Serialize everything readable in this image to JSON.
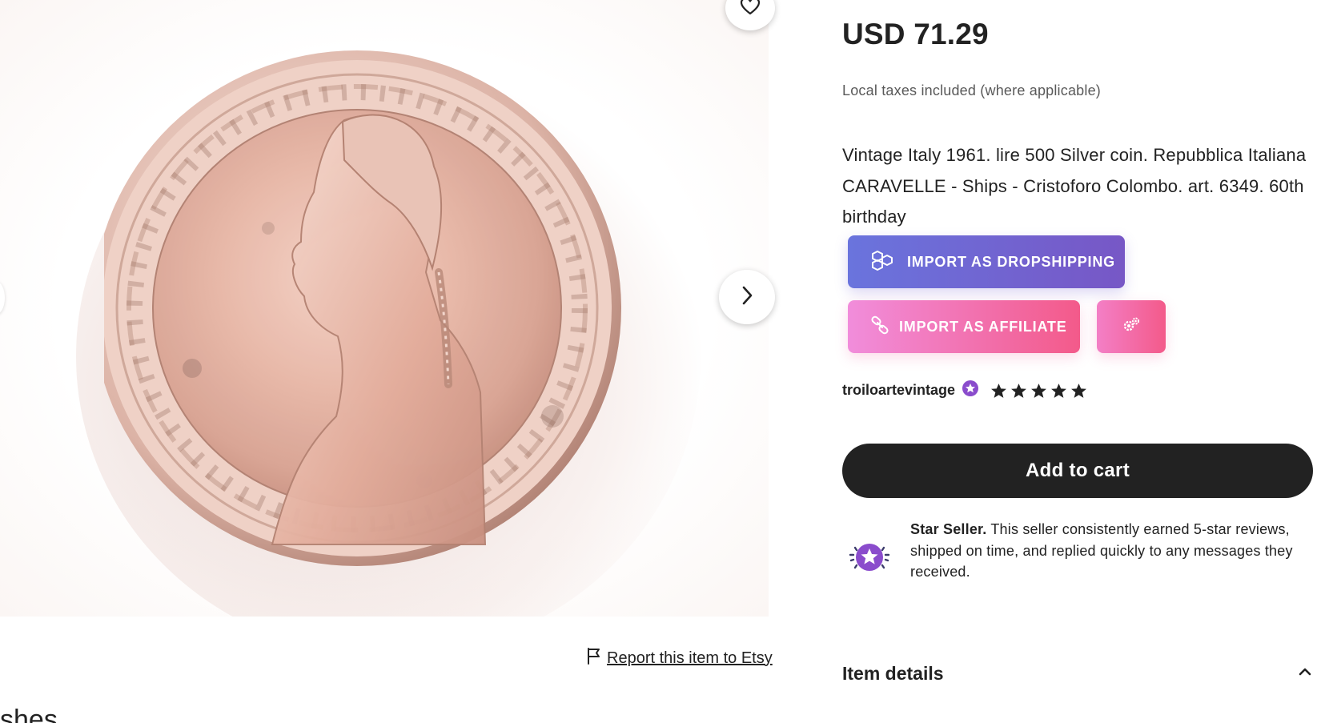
{
  "listing": {
    "price": "USD 71.29",
    "taxes_note": "Local taxes included (where applicable)",
    "title": "Vintage Italy 1961. lire 500 Silver coin. Repubblica Italiana CARAVELLE - Ships - Cristoforo Colombo. art. 6349. 60th birthday"
  },
  "actions": {
    "import_dropshipping": "IMPORT AS DROPSHIPPING",
    "import_affiliate": "IMPORT AS AFFILIATE",
    "add_to_cart": "Add to cart"
  },
  "seller": {
    "name": "troiloartevintage",
    "rating": 5,
    "rating_max": 5,
    "star_seller_heading": "Star Seller.",
    "star_seller_text": " This seller consistently earned 5-star reviews, shipped on time, and replied quickly to any messages they received."
  },
  "gallery": {
    "report_link": "Report this item to Etsy",
    "cut_off_text": "shes"
  },
  "item_details": {
    "heading": "Item details"
  },
  "colors": {
    "dropshipping_gradient": [
      "#6a74dd",
      "#7757c6"
    ],
    "affiliate_gradient": [
      "#f18ddb",
      "#f35a8a"
    ],
    "star_seller_purple": "#8a4ccc",
    "cart_bg": "#222222"
  },
  "icons": {
    "favorite": "heart-icon",
    "next_image": "chevron-right-icon",
    "report": "flag-icon",
    "dropshipping": "boxes-icon",
    "affiliate": "link-icon",
    "settings": "gears-icon",
    "star_seller_badge": "star-badge-icon",
    "details_toggle": "chevron-up-icon"
  }
}
